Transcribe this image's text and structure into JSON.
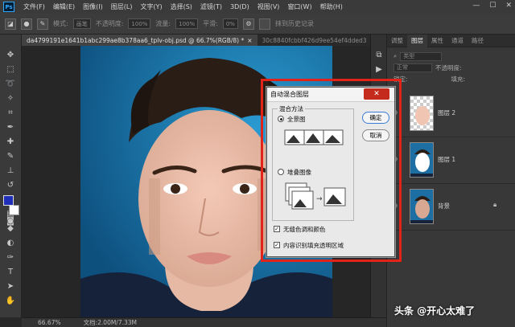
{
  "menu": [
    "文件(F)",
    "编辑(E)",
    "图像(I)",
    "图层(L)",
    "文字(Y)",
    "选择(S)",
    "滤镜(T)",
    "3D(D)",
    "视图(V)",
    "窗口(W)",
    "帮助(H)"
  ],
  "options": {
    "mode_label": "模式:",
    "mode_value": "画笔",
    "opacity_label": "不透明度:",
    "opacity_value": "100%",
    "flow_label": "流量:",
    "flow_value": "100%",
    "smooth_label": "平滑:",
    "smooth_value": "0%",
    "history_label": "抹到历史记录"
  },
  "tabs": [
    {
      "label": "da4799191e1641b1abc299ae8b378aa6_tplv-obj.psd @ 66.7%(RGB/8) *",
      "close": "×"
    },
    {
      "label": "30c8840fcbbf426d9ee54ef4dded3",
      "close": ""
    }
  ],
  "status": {
    "zoom": "66.67%",
    "doc": "文档:2.00M/7.33M"
  },
  "panel": {
    "tabs": [
      "调整",
      "图层",
      "属性",
      "通道",
      "路径"
    ],
    "kind_label": "类型",
    "blend_mode": "正常",
    "opacity_label": "不透明度:",
    "lock_label": "锁定:",
    "fill_label": "填充:",
    "layers": [
      {
        "name": "图层 2"
      },
      {
        "name": "图层 1"
      },
      {
        "name": "背景"
      }
    ]
  },
  "dialog": {
    "title": "自动混合图层",
    "close": "✕",
    "group_title": "混合方法",
    "option1": "全景图",
    "option2": "堆叠图像",
    "ok": "确定",
    "cancel": "取消",
    "check1": "无缝色调和颜色",
    "check2": "内容识别填充透明区域"
  },
  "watermark": "头条 @开心太难了",
  "colors": {
    "foreground": "#1f2fb8",
    "background": "#ffffff",
    "highlight": "#e2231a"
  }
}
